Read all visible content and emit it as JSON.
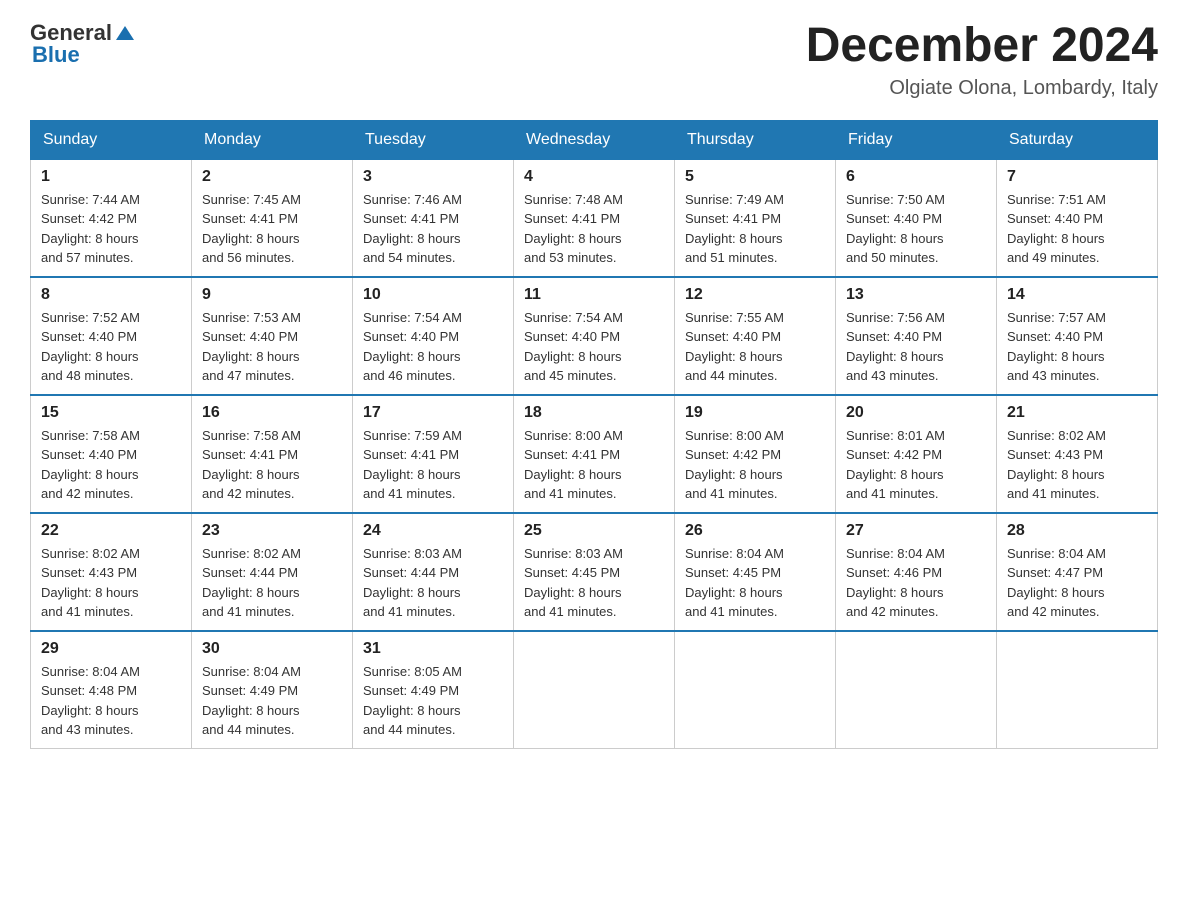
{
  "header": {
    "logo_general": "General",
    "logo_blue": "Blue",
    "month_title": "December 2024",
    "location": "Olgiate Olona, Lombardy, Italy"
  },
  "days_of_week": [
    "Sunday",
    "Monday",
    "Tuesday",
    "Wednesday",
    "Thursday",
    "Friday",
    "Saturday"
  ],
  "weeks": [
    [
      {
        "day": "1",
        "info": "Sunrise: 7:44 AM\nSunset: 4:42 PM\nDaylight: 8 hours\nand 57 minutes."
      },
      {
        "day": "2",
        "info": "Sunrise: 7:45 AM\nSunset: 4:41 PM\nDaylight: 8 hours\nand 56 minutes."
      },
      {
        "day": "3",
        "info": "Sunrise: 7:46 AM\nSunset: 4:41 PM\nDaylight: 8 hours\nand 54 minutes."
      },
      {
        "day": "4",
        "info": "Sunrise: 7:48 AM\nSunset: 4:41 PM\nDaylight: 8 hours\nand 53 minutes."
      },
      {
        "day": "5",
        "info": "Sunrise: 7:49 AM\nSunset: 4:41 PM\nDaylight: 8 hours\nand 51 minutes."
      },
      {
        "day": "6",
        "info": "Sunrise: 7:50 AM\nSunset: 4:40 PM\nDaylight: 8 hours\nand 50 minutes."
      },
      {
        "day": "7",
        "info": "Sunrise: 7:51 AM\nSunset: 4:40 PM\nDaylight: 8 hours\nand 49 minutes."
      }
    ],
    [
      {
        "day": "8",
        "info": "Sunrise: 7:52 AM\nSunset: 4:40 PM\nDaylight: 8 hours\nand 48 minutes."
      },
      {
        "day": "9",
        "info": "Sunrise: 7:53 AM\nSunset: 4:40 PM\nDaylight: 8 hours\nand 47 minutes."
      },
      {
        "day": "10",
        "info": "Sunrise: 7:54 AM\nSunset: 4:40 PM\nDaylight: 8 hours\nand 46 minutes."
      },
      {
        "day": "11",
        "info": "Sunrise: 7:54 AM\nSunset: 4:40 PM\nDaylight: 8 hours\nand 45 minutes."
      },
      {
        "day": "12",
        "info": "Sunrise: 7:55 AM\nSunset: 4:40 PM\nDaylight: 8 hours\nand 44 minutes."
      },
      {
        "day": "13",
        "info": "Sunrise: 7:56 AM\nSunset: 4:40 PM\nDaylight: 8 hours\nand 43 minutes."
      },
      {
        "day": "14",
        "info": "Sunrise: 7:57 AM\nSunset: 4:40 PM\nDaylight: 8 hours\nand 43 minutes."
      }
    ],
    [
      {
        "day": "15",
        "info": "Sunrise: 7:58 AM\nSunset: 4:40 PM\nDaylight: 8 hours\nand 42 minutes."
      },
      {
        "day": "16",
        "info": "Sunrise: 7:58 AM\nSunset: 4:41 PM\nDaylight: 8 hours\nand 42 minutes."
      },
      {
        "day": "17",
        "info": "Sunrise: 7:59 AM\nSunset: 4:41 PM\nDaylight: 8 hours\nand 41 minutes."
      },
      {
        "day": "18",
        "info": "Sunrise: 8:00 AM\nSunset: 4:41 PM\nDaylight: 8 hours\nand 41 minutes."
      },
      {
        "day": "19",
        "info": "Sunrise: 8:00 AM\nSunset: 4:42 PM\nDaylight: 8 hours\nand 41 minutes."
      },
      {
        "day": "20",
        "info": "Sunrise: 8:01 AM\nSunset: 4:42 PM\nDaylight: 8 hours\nand 41 minutes."
      },
      {
        "day": "21",
        "info": "Sunrise: 8:02 AM\nSunset: 4:43 PM\nDaylight: 8 hours\nand 41 minutes."
      }
    ],
    [
      {
        "day": "22",
        "info": "Sunrise: 8:02 AM\nSunset: 4:43 PM\nDaylight: 8 hours\nand 41 minutes."
      },
      {
        "day": "23",
        "info": "Sunrise: 8:02 AM\nSunset: 4:44 PM\nDaylight: 8 hours\nand 41 minutes."
      },
      {
        "day": "24",
        "info": "Sunrise: 8:03 AM\nSunset: 4:44 PM\nDaylight: 8 hours\nand 41 minutes."
      },
      {
        "day": "25",
        "info": "Sunrise: 8:03 AM\nSunset: 4:45 PM\nDaylight: 8 hours\nand 41 minutes."
      },
      {
        "day": "26",
        "info": "Sunrise: 8:04 AM\nSunset: 4:45 PM\nDaylight: 8 hours\nand 41 minutes."
      },
      {
        "day": "27",
        "info": "Sunrise: 8:04 AM\nSunset: 4:46 PM\nDaylight: 8 hours\nand 42 minutes."
      },
      {
        "day": "28",
        "info": "Sunrise: 8:04 AM\nSunset: 4:47 PM\nDaylight: 8 hours\nand 42 minutes."
      }
    ],
    [
      {
        "day": "29",
        "info": "Sunrise: 8:04 AM\nSunset: 4:48 PM\nDaylight: 8 hours\nand 43 minutes."
      },
      {
        "day": "30",
        "info": "Sunrise: 8:04 AM\nSunset: 4:49 PM\nDaylight: 8 hours\nand 44 minutes."
      },
      {
        "day": "31",
        "info": "Sunrise: 8:05 AM\nSunset: 4:49 PM\nDaylight: 8 hours\nand 44 minutes."
      },
      {
        "day": "",
        "info": ""
      },
      {
        "day": "",
        "info": ""
      },
      {
        "day": "",
        "info": ""
      },
      {
        "day": "",
        "info": ""
      }
    ]
  ]
}
